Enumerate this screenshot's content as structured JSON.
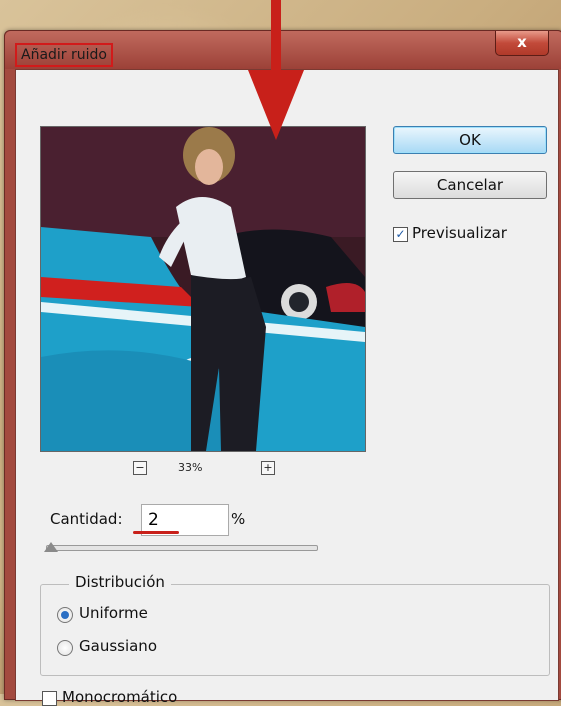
{
  "dialog": {
    "title": "Añadir ruido",
    "close_glyph": "x",
    "ok_label": "OK",
    "cancel_label": "Cancelar",
    "preview_label": "Previsualizar",
    "preview_checked": true,
    "zoom_level": "33%",
    "zoom_out_glyph": "−",
    "zoom_in_glyph": "+",
    "amount_label": "Cantidad:",
    "amount_value": "2",
    "amount_unit": "%",
    "slider_value_percent": 2,
    "distribution_title": "Distribución",
    "distribution_options": [
      {
        "label": "Uniforme",
        "selected": true
      },
      {
        "label": "Gaussiano",
        "selected": false
      }
    ],
    "monochrome_label": "Monocromático",
    "monochrome_checked": false
  },
  "annotation_color": "#c8201a",
  "ok_button_accent": "#a7d9f5",
  "title_bar_color": "#a34a3f"
}
